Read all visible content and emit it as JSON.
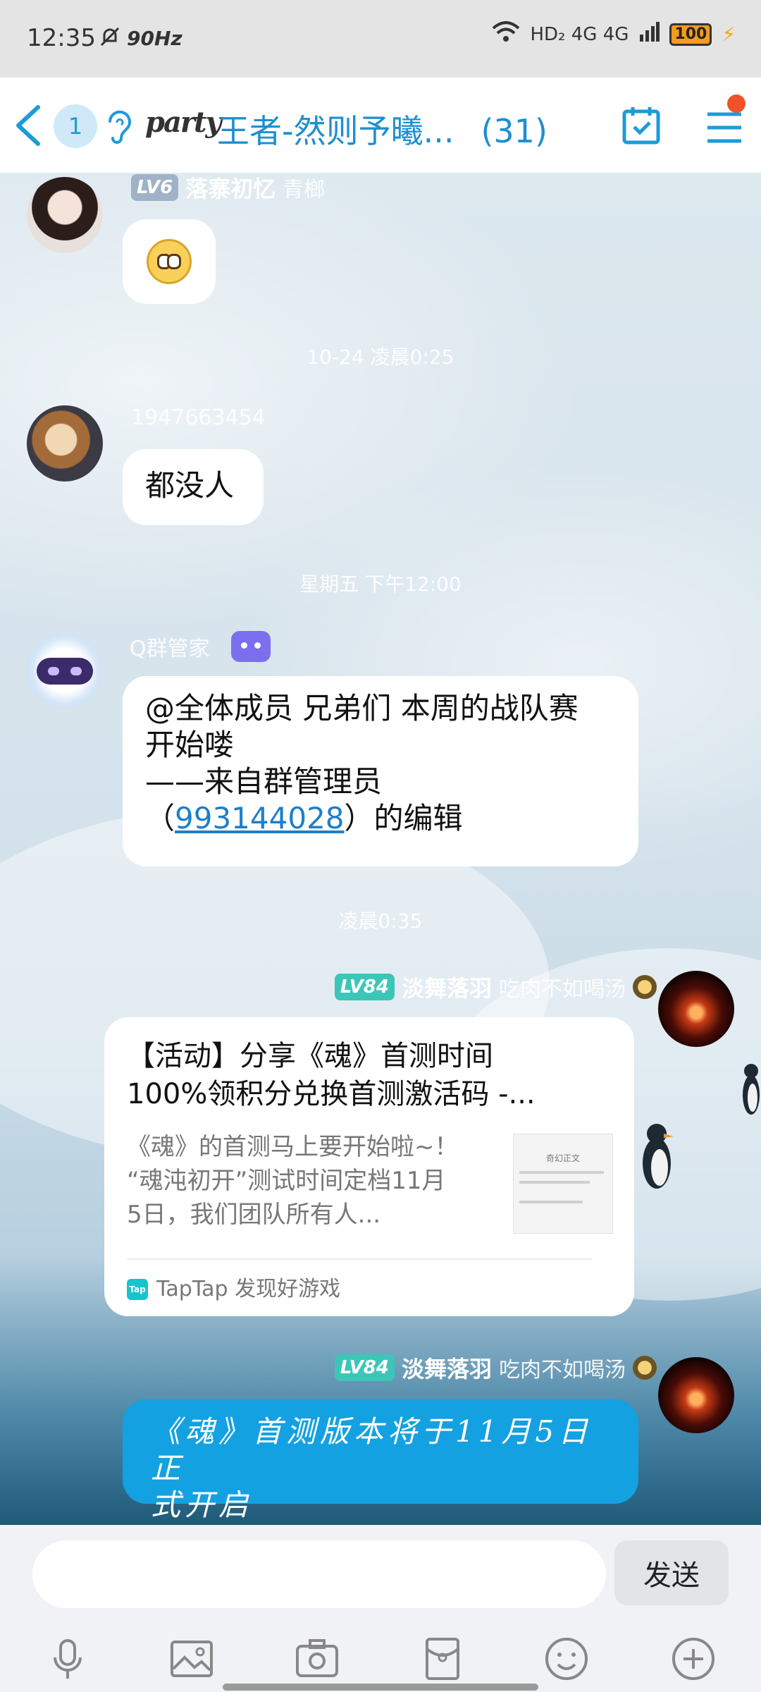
{
  "status_bar": {
    "time": "12:35",
    "refresh_rate": "90Hz",
    "network": "HD₂ 4G 4G",
    "battery": "100"
  },
  "header": {
    "unread_count": "1",
    "logo_text": "party",
    "title": "王者-然则予曦...",
    "member_count": "(31)"
  },
  "messages": [
    {
      "level": "LV6",
      "nickname": "落寨初忆",
      "title_badge": "青榔",
      "content_type": "emoji",
      "emoji": "shocked-face"
    },
    {
      "timestamp": "10-24 凌晨0:25"
    },
    {
      "nickname": "1947663454",
      "text": "都没人"
    },
    {
      "timestamp": "星期五 下午12:00"
    },
    {
      "nickname": "Q群管家",
      "line1": "@全体成员 兄弟们 本周的战队赛",
      "line2": "开始喽",
      "line3": "——来自群管理员",
      "line4_prefix": "（",
      "link_number": "993144028",
      "line4_suffix": "）的编辑"
    },
    {
      "timestamp": "凌晨0:35"
    },
    {
      "level": "LV84",
      "nickname": "淡舞落羽",
      "title_badge": "吃肉不如喝汤",
      "card": {
        "title_line1": "【活动】分享《魂》首测时间",
        "title_line2": "100%领积分兑换首测激活码 -...",
        "desc_line1": "《魂》的首测马上要开始啦~！",
        "desc_line2": "“魂沌初开”测试时间定档11月",
        "desc_line3": "5日，我们团队所有人...",
        "thumb_label": "奇幻正文",
        "source_icon": "Tap",
        "source": "TapTap 发现好游戏"
      }
    },
    {
      "level": "LV84",
      "nickname": "淡舞落羽",
      "title_badge": "吃肉不如喝汤",
      "line1": "《魂》首测版本将于11月5日正",
      "line2": "式开启"
    }
  ],
  "input": {
    "placeholder": "",
    "send_label": "发送"
  },
  "toolbar_icons": [
    "microphone-icon",
    "image-icon",
    "camera-icon",
    "red-packet-icon",
    "emoji-icon",
    "plus-icon"
  ],
  "colors": {
    "accent": "#13a1e1",
    "title": "#1d8fd0",
    "notification_dot": "#f0532b"
  }
}
